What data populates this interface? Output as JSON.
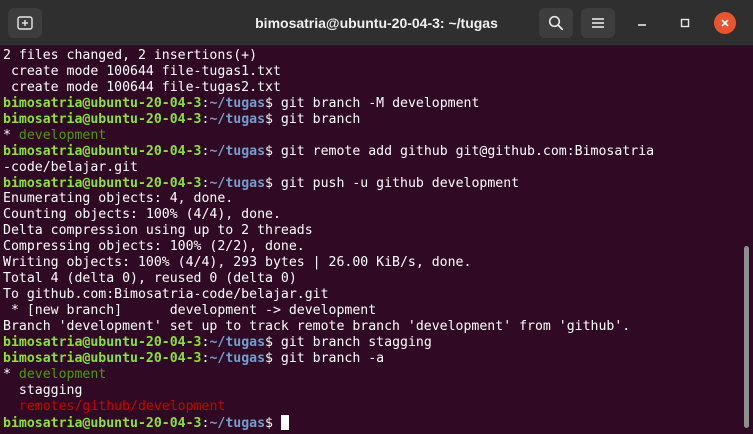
{
  "window": {
    "title": "bimosatria@ubuntu-20-04-3: ~/tugas"
  },
  "titlebar": {
    "new_tab_icon": "new-tab-icon",
    "search_icon": "search-icon",
    "menu_icon": "hamburger-menu-icon",
    "minimize_icon": "minimize-icon",
    "maximize_icon": "maximize-icon",
    "close_icon": "close-icon",
    "close_color": "#e9542f"
  },
  "terminal": {
    "background": "#300a24",
    "colors": {
      "user": "#8ae234",
      "path": "#729fcf",
      "branch_current": "#4e9a06",
      "branch_remote": "#cc0000"
    },
    "prompt_user": "bimosatria@ubuntu-20-04-3",
    "prompt_path": "~/tugas",
    "lines": [
      {
        "segments": [
          {
            "text": "2 files changed, 2 insertions(+)",
            "style": "n"
          }
        ]
      },
      {
        "segments": [
          {
            "text": " create mode 100644 file-tugas1.txt",
            "style": "n"
          }
        ]
      },
      {
        "segments": [
          {
            "text": " create mode 100644 file-tugas2.txt",
            "style": "n"
          }
        ]
      },
      {
        "segments": [
          {
            "text": "bimosatria@ubuntu-20-04-3",
            "style": "u"
          },
          {
            "text": ":",
            "style": "n"
          },
          {
            "text": "~/tugas",
            "style": "p"
          },
          {
            "text": "$ git branch -M development",
            "style": "n"
          }
        ]
      },
      {
        "segments": [
          {
            "text": "bimosatria@ubuntu-20-04-3",
            "style": "u"
          },
          {
            "text": ":",
            "style": "n"
          },
          {
            "text": "~/tugas",
            "style": "p"
          },
          {
            "text": "$ git branch",
            "style": "n"
          }
        ]
      },
      {
        "segments": [
          {
            "text": "* ",
            "style": "n"
          },
          {
            "text": "development",
            "style": "g"
          }
        ]
      },
      {
        "segments": [
          {
            "text": "bimosatria@ubuntu-20-04-3",
            "style": "u"
          },
          {
            "text": ":",
            "style": "n"
          },
          {
            "text": "~/tugas",
            "style": "p"
          },
          {
            "text": "$ git remote add github git@github.com:Bimosatria",
            "style": "n"
          }
        ]
      },
      {
        "segments": [
          {
            "text": "-code/belajar.git",
            "style": "n"
          }
        ]
      },
      {
        "segments": [
          {
            "text": "bimosatria@ubuntu-20-04-3",
            "style": "u"
          },
          {
            "text": ":",
            "style": "n"
          },
          {
            "text": "~/tugas",
            "style": "p"
          },
          {
            "text": "$ git push -u github development",
            "style": "n"
          }
        ]
      },
      {
        "segments": [
          {
            "text": "Enumerating objects: 4, done.",
            "style": "n"
          }
        ]
      },
      {
        "segments": [
          {
            "text": "Counting objects: 100% (4/4), done.",
            "style": "n"
          }
        ]
      },
      {
        "segments": [
          {
            "text": "Delta compression using up to 2 threads",
            "style": "n"
          }
        ]
      },
      {
        "segments": [
          {
            "text": "Compressing objects: 100% (2/2), done.",
            "style": "n"
          }
        ]
      },
      {
        "segments": [
          {
            "text": "Writing objects: 100% (4/4), 293 bytes | 26.00 KiB/s, done.",
            "style": "n"
          }
        ]
      },
      {
        "segments": [
          {
            "text": "Total 4 (delta 0), reused 0 (delta 0)",
            "style": "n"
          }
        ]
      },
      {
        "segments": [
          {
            "text": "To github.com:Bimosatria-code/belajar.git",
            "style": "n"
          }
        ]
      },
      {
        "segments": [
          {
            "text": " * [new branch]      development -> development",
            "style": "n"
          }
        ]
      },
      {
        "segments": [
          {
            "text": "Branch 'development' set up to track remote branch 'development' from 'github'.",
            "style": "n"
          }
        ]
      },
      {
        "segments": [
          {
            "text": "bimosatria@ubuntu-20-04-3",
            "style": "u"
          },
          {
            "text": ":",
            "style": "n"
          },
          {
            "text": "~/tugas",
            "style": "p"
          },
          {
            "text": "$ git branch stagging",
            "style": "n"
          }
        ]
      },
      {
        "segments": [
          {
            "text": "bimosatria@ubuntu-20-04-3",
            "style": "u"
          },
          {
            "text": ":",
            "style": "n"
          },
          {
            "text": "~/tugas",
            "style": "p"
          },
          {
            "text": "$ git branch -a",
            "style": "n"
          }
        ]
      },
      {
        "segments": [
          {
            "text": "* ",
            "style": "n"
          },
          {
            "text": "development",
            "style": "g"
          }
        ]
      },
      {
        "segments": [
          {
            "text": "  stagging",
            "style": "n"
          }
        ]
      },
      {
        "segments": [
          {
            "text": "  ",
            "style": "n"
          },
          {
            "text": "remotes/github/development",
            "style": "r"
          }
        ]
      },
      {
        "segments": [
          {
            "text": "bimosatria@ubuntu-20-04-3",
            "style": "u"
          },
          {
            "text": ":",
            "style": "n"
          },
          {
            "text": "~/tugas",
            "style": "p"
          },
          {
            "text": "$ ",
            "style": "n"
          }
        ],
        "cursor": true
      }
    ]
  }
}
